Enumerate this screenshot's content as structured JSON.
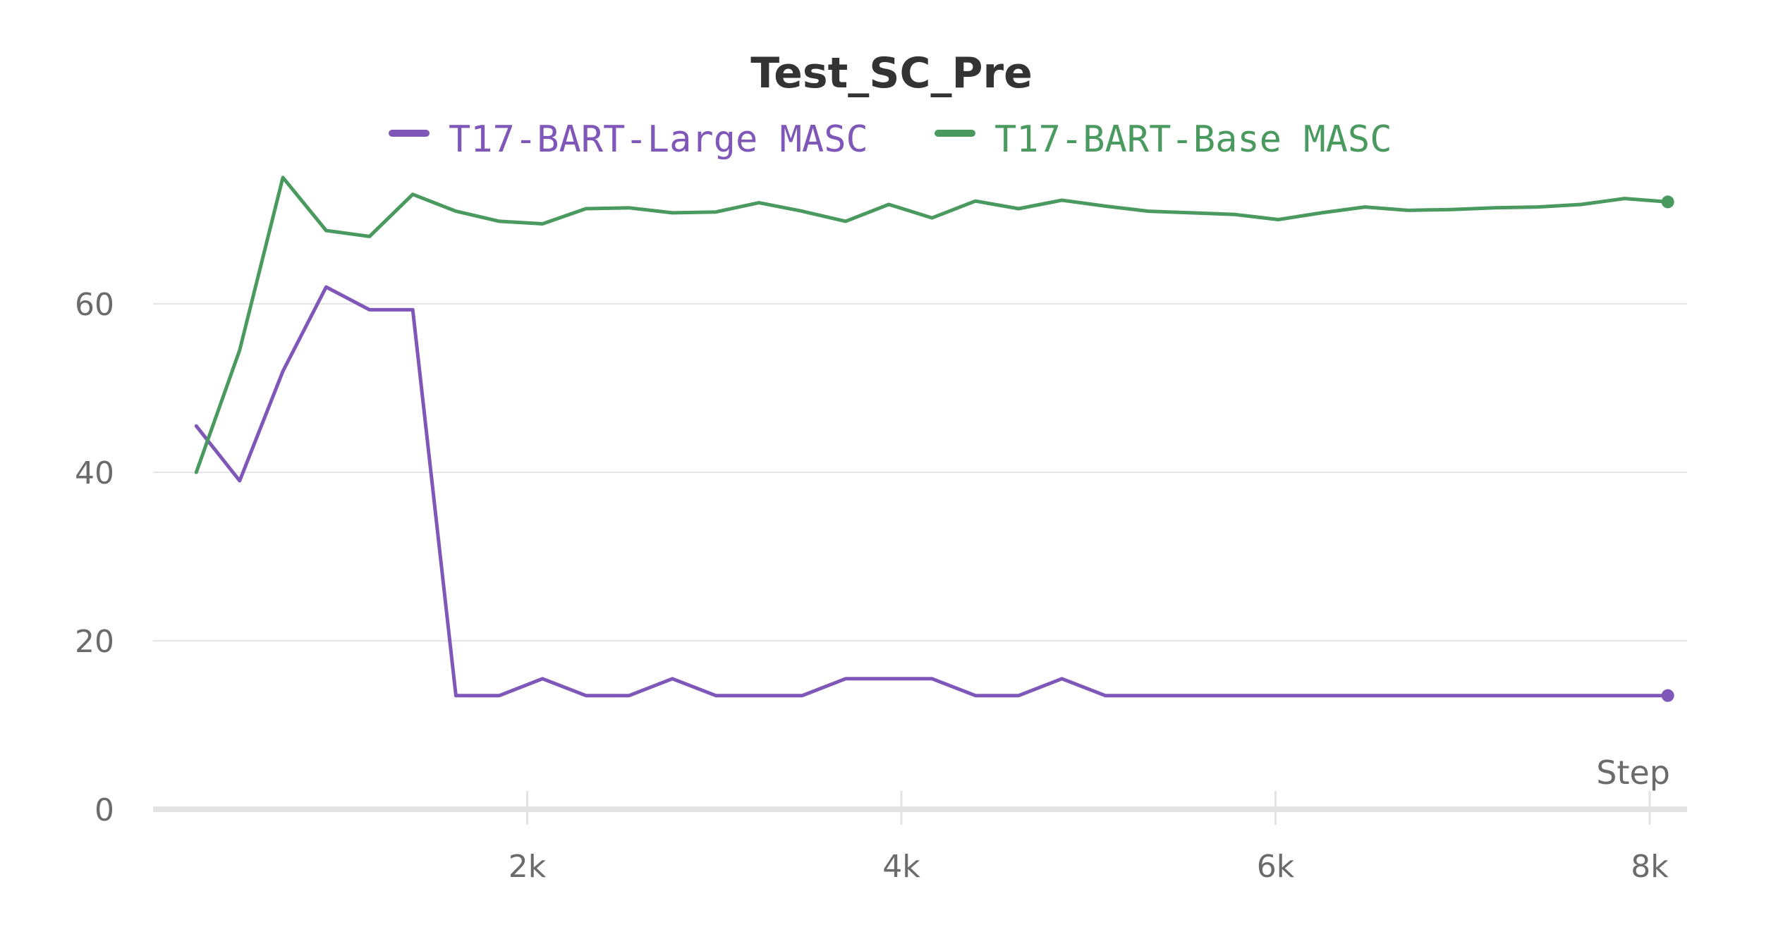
{
  "chart_data": {
    "type": "line",
    "title": "Test_SC_Pre",
    "xlabel": "Step",
    "ylabel": "",
    "xlim": [
      0,
      8200
    ],
    "ylim": [
      0,
      75
    ],
    "grid": true,
    "legend_position": "top-center",
    "x_ticks": [
      2000,
      4000,
      6000,
      8000
    ],
    "x_tick_labels": [
      "2k",
      "4k",
      "6k",
      "8k"
    ],
    "y_ticks": [
      0,
      20,
      40,
      60
    ],
    "y_tick_labels": [
      "0",
      "20",
      "40",
      "60"
    ],
    "x": [
      231,
      463,
      694,
      925,
      1157,
      1388,
      1619,
      1851,
      2082,
      2314,
      2545,
      2776,
      3008,
      3239,
      3470,
      3702,
      3933,
      4164,
      4396,
      4627,
      4858,
      5090,
      5321,
      5552,
      5784,
      6015,
      6246,
      6478,
      6709,
      6940,
      7172,
      7403,
      7634,
      7866,
      8097
    ],
    "series": [
      {
        "name": "T17-BART-Large MASC",
        "color": "#7e57b8",
        "values": [
          45.5,
          39,
          52,
          62,
          59.3,
          59.3,
          13.5,
          13.5,
          15.5,
          13.5,
          13.5,
          15.5,
          13.5,
          13.5,
          13.5,
          15.5,
          15.5,
          15.5,
          13.5,
          13.5,
          15.5,
          13.5,
          13.5,
          13.5,
          13.5,
          13.5,
          13.5,
          13.5,
          13.5,
          13.5,
          13.5,
          13.5,
          13.5,
          13.5,
          13.5
        ]
      },
      {
        "name": "T17-BART-Base MASC",
        "color": "#4a9a5f",
        "values": [
          40,
          54.5,
          75,
          68.7,
          68,
          73,
          71,
          69.8,
          69.5,
          71.3,
          71.4,
          70.8,
          70.9,
          72,
          71,
          69.8,
          71.8,
          70.2,
          72.2,
          71.3,
          72.3,
          71.6,
          71,
          70.8,
          70.6,
          70,
          70.8,
          71.5,
          71.1,
          71.2,
          71.4,
          71.5,
          71.8,
          72.5,
          72.1
        ]
      }
    ]
  }
}
